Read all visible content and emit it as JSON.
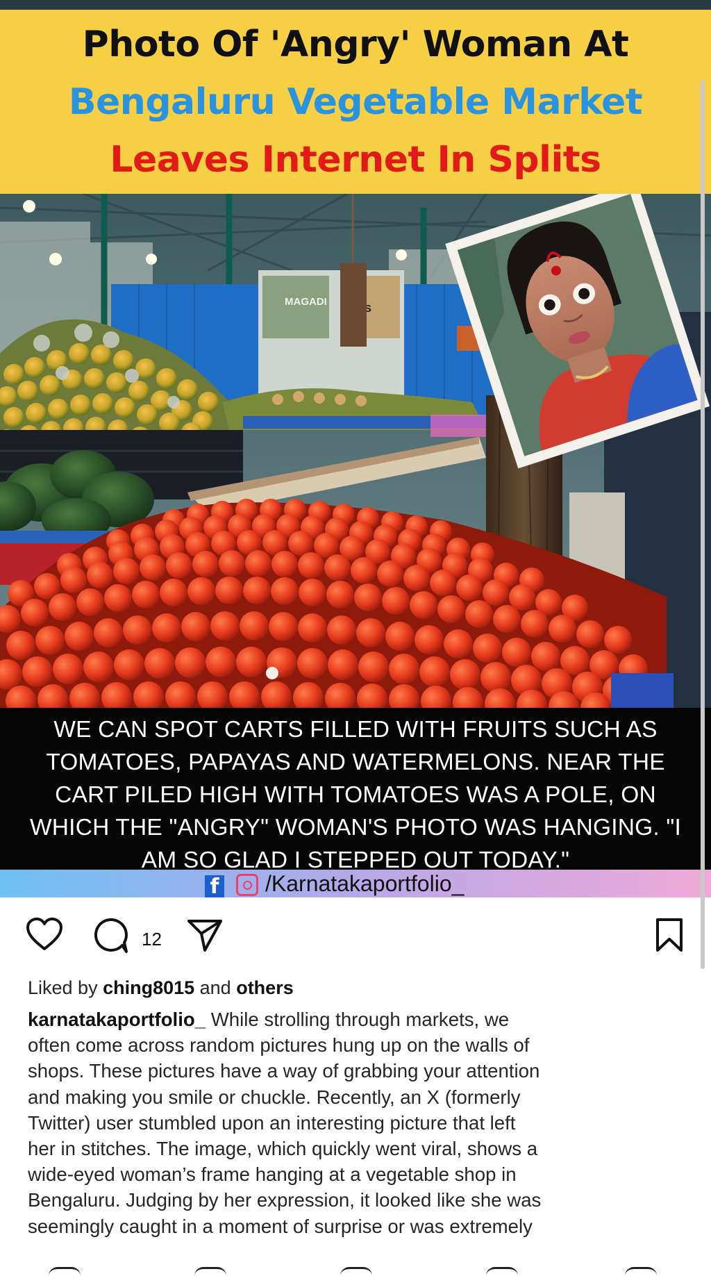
{
  "post": {
    "headline": {
      "line1": "Photo Of 'Angry' Woman At",
      "line2": "Bengaluru Vegetable Market",
      "line3": "Leaves Internet In Splits",
      "colors": {
        "background": "#f6cf45",
        "line1": "#111111",
        "line2": "#2a93e0",
        "line3": "#e11a17"
      }
    },
    "scene": {
      "banner_text": "MAGADI",
      "banner_text_2": "NS"
    },
    "caption_lines": [
      "WE CAN SPOT CARTS FILLED WITH FRUITS SUCH AS",
      "TOMATOES, PAPAYAS AND WATERMELONS. NEAR THE",
      "CART PILED HIGH WITH TOMATOES WAS A POLE, ON",
      "WHICH THE \"ANGRY\" WOMAN'S PHOTO WAS HANGING. \"I",
      "AM SO GLAD I STEPPED OUT TODAY.\""
    ],
    "handle": "/Karnatakaportfolio_",
    "handle_icons": [
      "facebook-icon",
      "instagram-icon"
    ]
  },
  "actions": {
    "icons": [
      "heart-icon",
      "comment-icon",
      "share-icon",
      "bookmark-icon"
    ],
    "comment_count": "12"
  },
  "likes": {
    "prefix": "Liked by ",
    "user": "ching8015",
    "middle": " and ",
    "others": "others"
  },
  "caption": {
    "username": "karnatakaportfolio_",
    "first_line_rest": " While strolling through markets, we",
    "lines": [
      "often come across random pictures hung up on the walls of",
      "shops. These pictures have a way of grabbing your attention",
      "and making you smile or chuckle. Recently, an X (formerly",
      "Twitter) user stumbled upon an interesting picture that left",
      "her in stitches. The image, which quickly went viral, shows a",
      "wide-eyed woman’s frame hanging at a vegetable shop in",
      "Bengaluru. Judging by her expression, it looked like she was",
      "seemingly caught in a moment of surprise or was extremely"
    ]
  }
}
